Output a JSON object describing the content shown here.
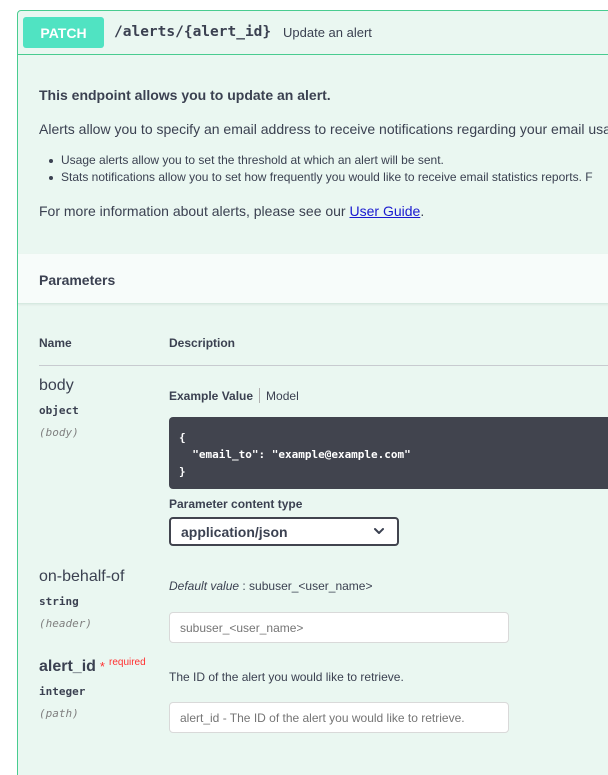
{
  "operation": {
    "method": "PATCH",
    "path": "/alerts/{alert_id}",
    "summary": "Update an alert"
  },
  "description": {
    "title": "This endpoint allows you to update an alert.",
    "paragraph": "Alerts allow you to specify an email address to receive notifications regarding your email usa",
    "bullets": [
      "Usage alerts allow you to set the threshold at which an alert will be sent.",
      "Stats notifications allow you to set how frequently you would like to receive email statistics reports. F"
    ],
    "more_prefix": "For more information about alerts, please see our ",
    "more_link": "User Guide",
    "more_suffix": "."
  },
  "parameters": {
    "header": "Parameters",
    "col_name": "Name",
    "col_description": "Description",
    "items": [
      {
        "name": "body",
        "type": "object",
        "in": "(body)",
        "tab_example": "Example Value",
        "tab_model": "Model",
        "example": "{\n  \"email_to\": \"example@example.com\"\n}",
        "content_type_label": "Parameter content type",
        "content_type_value": "application/json"
      },
      {
        "name": "on-behalf-of",
        "type": "string",
        "in": "(header)",
        "default_label": "Default value",
        "default_value": " : subuser_<user_name>",
        "placeholder": "subuser_<user_name>"
      },
      {
        "name": "alert_id",
        "required_star": "*",
        "required_text": "required",
        "type": "integer",
        "in": "(path)",
        "description": "The ID of the alert you would like to retrieve.",
        "placeholder": "alert_id - The ID of the alert you would like to retrieve."
      }
    ]
  },
  "colors": {
    "method_bg": "#50e3c2",
    "border": "#49cc90",
    "block_bg": "#eaf7f1",
    "required": "#ff3030"
  },
  "icons": {
    "select_chevron": "chevron-down-icon"
  }
}
